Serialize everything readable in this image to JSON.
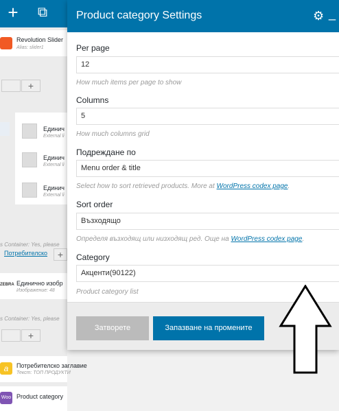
{
  "toolbar": {
    "add_icon": "+",
    "layout_icon": "⧉"
  },
  "builder": {
    "el1": {
      "title": "Revolution Slider",
      "sub": "Alias: slider1"
    },
    "el2": {
      "title": "Единич",
      "sub": "External li"
    },
    "el3": {
      "title": "Единич",
      "sub": "External li"
    },
    "el4": {
      "title": "Единич",
      "sub": "External li"
    },
    "container_note_1": "s Container: Yes, please",
    "link_text": "Потребителско",
    "el5": {
      "title": "Единично изобр",
      "sub": "Изображение: 48"
    },
    "container_note_2": "s Container: Yes, please",
    "el6": {
      "title": "Потребителско заглавие",
      "sub": "Текст: ТОП ПРОДУКТИ",
      "icon_text": "a"
    },
    "el7": {
      "title": "Product category",
      "icon_text": "Woo"
    },
    "el5_icon_text": "ZEBRA"
  },
  "modal": {
    "title": "Product category Settings",
    "fields": [
      {
        "label": "Per page",
        "value": "12",
        "help": "How much items per page to show"
      },
      {
        "label": "Columns",
        "value": "5",
        "help": "How much columns grid"
      },
      {
        "label": "Подреждане по",
        "value": "Menu order & title",
        "help_prefix": "Select how to sort retrieved products. More at ",
        "help_link": "WordPress codex page",
        "help_suffix": "."
      },
      {
        "label": "Sort order",
        "value": "Възходящо",
        "help_prefix": "Определя възходящ или низходящ ред. Още на ",
        "help_link": "WordPress codex page",
        "help_suffix": "."
      },
      {
        "label": "Category",
        "value": "Акценти(90122)",
        "help": "Product category list"
      }
    ],
    "close_label": "Затворете",
    "save_label": "Запазване на промените"
  }
}
